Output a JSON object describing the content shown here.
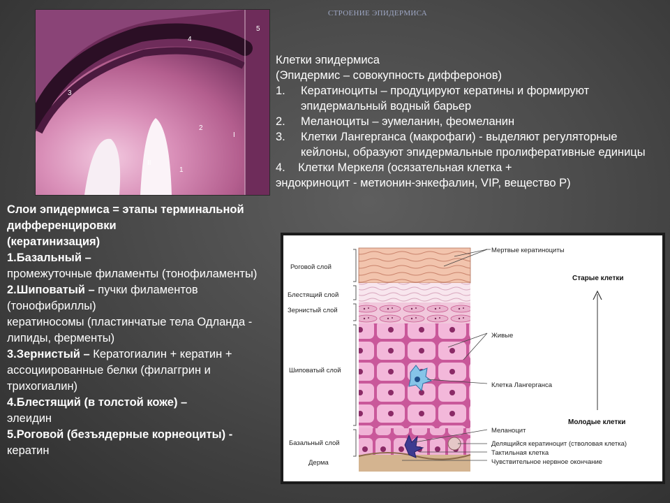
{
  "slide": {
    "title": "СТРОЕНИЕ ЭПИДЕРМИСА"
  },
  "photo": {
    "labels": [
      "5",
      "4",
      "3",
      "2",
      "I",
      "II",
      "1"
    ]
  },
  "cells": {
    "heading1": "Клетки эпидермиса",
    "heading2": "(Эпидермис – совокупность дифферонов)",
    "items": [
      {
        "num": "1.",
        "text": "Кератиноциты – продуцируют кератины и формируют эпидермальный водный барьер"
      },
      {
        "num": "2.",
        "text": "Меланоциты – эумеланин, феомеланин"
      },
      {
        "num": "3.",
        "text": "Клетки Лангерганса (макрофаги) - выделяют регуляторные кейлоны, образуют эпидермальные пролиферативные единицы"
      }
    ],
    "item4_line1": "4.    Клетки Меркеля (осязательная клетка +",
    "item4_line2": "эндокриноцит - метионин-энкефалин, VIP,  вещество Р)"
  },
  "layers": {
    "heading": "Слои эпидермиса = этапы терминальной дифференцировки",
    "heading_sub": "(кератинизация)",
    "l1_bold": "1.Базальный –",
    "l1_text": "промежуточные филаменты (тонофиламенты)",
    "l2_bold": "2.Шиповатый –",
    "l2_text": " пучки филаментов (тонофибриллы)",
    "l2_text2": "кератиносомы (пластинчатые тела Одланда - липиды, ферменты)",
    "l3_bold": "3.Зернистый –",
    "l3_text": " Кератогиалин + кератин + ассоциированные белки (филаггрин и трихогиалин)",
    "l4_bold": "4.Блестящий (в толстой коже) –",
    "l4_text": "элеидин",
    "l5_bold": "5.Роговой (безъядерные корнеоциты) -",
    "l5_text": " кератин"
  },
  "diagram": {
    "left_labels": {
      "horny": "Роговой слой",
      "lucid": "Блестящий слой",
      "granular": "Зернистый слой",
      "spinous": "Шиповатый слой",
      "basal": "Базальный слой",
      "dermis": "Дерма"
    },
    "right_labels": {
      "dead": "Мертвые кератиноциты",
      "alive": "Живые",
      "langerhans": "Клетка Лангерганса",
      "melanocyte": "Меланоцит",
      "dividing": "Делящийся кератиноцит (стволовая клетка)",
      "tactile": "Тактильная клетка",
      "nerve": "Чувствительное нервное окончание"
    },
    "old_cells": "Старые клетки",
    "young_cells": "Молодые клетки"
  }
}
